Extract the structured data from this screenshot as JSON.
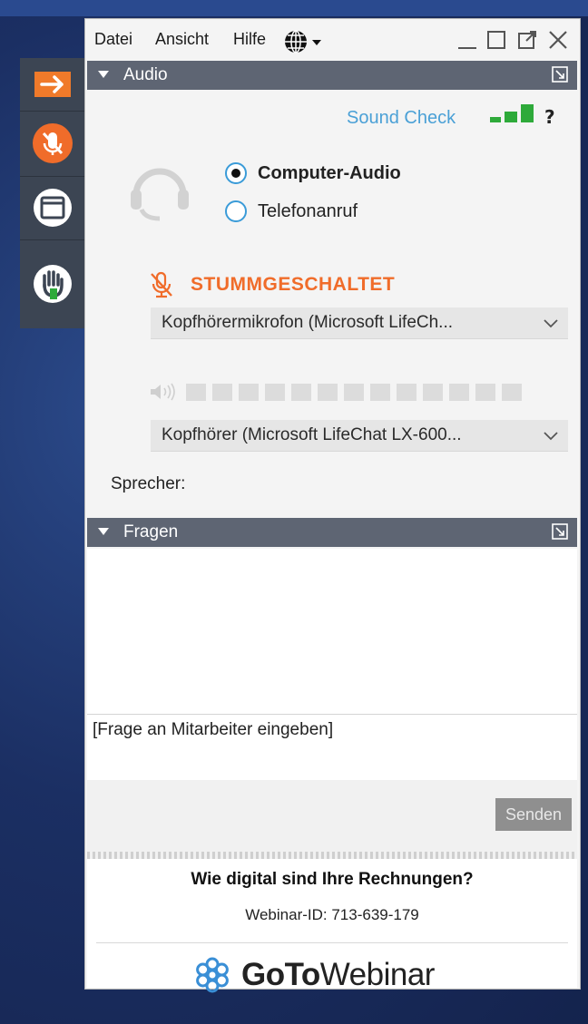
{
  "menu": {
    "items": [
      "Datei",
      "Ansicht",
      "Hilfe"
    ]
  },
  "audio": {
    "title": "Audio",
    "sound_check": "Sound Check",
    "help": "?",
    "options": [
      "Computer-Audio",
      "Telefonanruf"
    ],
    "selected_option": "Computer-Audio",
    "muted_label": "STUMMGESCHALTET",
    "microphone": "Kopfhörermikrofon (Microsoft LifeCh...",
    "speaker_device": "Kopfhörer (Microsoft LifeChat LX-600...",
    "speaker_label": "Sprecher:"
  },
  "questions": {
    "title": "Fragen",
    "placeholder": "[Frage an Mitarbeiter eingeben]",
    "send_label": "Senden"
  },
  "footer": {
    "webinar_title": "Wie digital sind Ihre Rechnungen?",
    "webinar_id": "Webinar-ID: 713-639-179",
    "brand_bold": "GoTo",
    "brand_light": "Webinar"
  },
  "colors": {
    "accent_orange": "#f06c2a",
    "link_blue": "#4aa0d6",
    "header_gray": "#5e6573",
    "signal_green": "#2eaa3a"
  },
  "icons": [
    "arrow-right-icon",
    "microphone-muted-icon",
    "screen-icon",
    "raise-hand-icon",
    "globe-icon",
    "headset-icon",
    "speaker-icon",
    "chevron-down-icon",
    "popout-icon",
    "gotowebinar-logo-icon"
  ]
}
